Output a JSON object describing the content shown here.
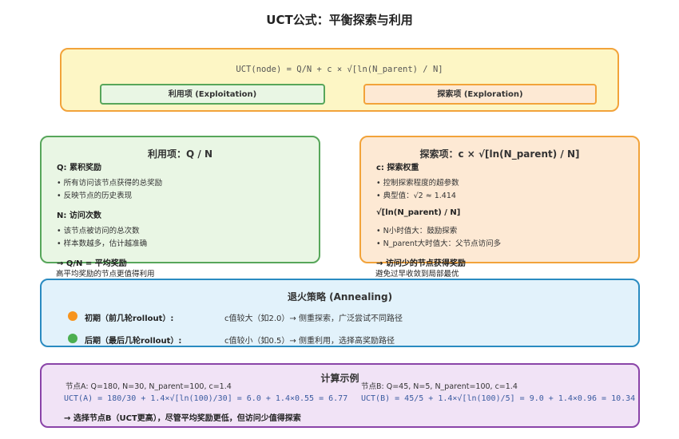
{
  "title": "UCT公式：平衡探索与利用",
  "formula": {
    "text": "UCT(node) = Q/N + c × √[ln(N_parent) / N]",
    "exploit_label": "利用项 (Exploitation)",
    "explore_label": "探索项 (Exploration)"
  },
  "exploit": {
    "title": "利用项：Q / N",
    "q_heading": "Q: 累积奖励",
    "q_items": [
      "• 所有访问该节点获得的总奖励",
      "• 反映节点的历史表现"
    ],
    "n_heading": "N: 访问次数",
    "n_items": [
      "• 该节点被访问的总次数",
      "• 样本数越多，估计越准确"
    ],
    "conclusion": "→ Q/N = 平均奖励",
    "note": "高平均奖励的节点更值得利用"
  },
  "explore": {
    "title": "探索项：c × √[ln(N_parent) / N]",
    "c_heading": "c: 探索权重",
    "c_items": [
      "• 控制探索程度的超参数",
      "• 典型值：√2 ≈ 1.414"
    ],
    "sqrt_heading": "√[ln(N_parent) / N]",
    "sqrt_items": [
      "• N小时值大：鼓励探索",
      "• N_parent大时值大：父节点访问多"
    ],
    "conclusion": "→ 访问少的节点获得奖励",
    "note": "避免过早收敛到局部最优"
  },
  "annealing": {
    "title": "退火策略 (Annealing)",
    "early_label": "初期（前几轮rollout）:",
    "early_desc": "c值较大（如2.0）→ 侧重探索，广泛尝试不同路径",
    "late_label": "后期（最后几轮rollout）:",
    "late_desc": "c值较小（如0.5）→ 侧重利用，选择高奖励路径",
    "colors": {
      "early": "#f7941d",
      "late": "#4caf50"
    }
  },
  "calc": {
    "title": "计算示例",
    "node_a": "节点A: Q=180, N=30, N_parent=100, c=1.4",
    "node_b": "节点B: Q=45, N=5, N_parent=100, c=1.4",
    "formula_a": "UCT(A) = 180/30 + 1.4×√[ln(100)/30] = 6.0 + 1.4×0.55 = 6.77",
    "formula_b": "UCT(B) = 45/5 + 1.4×√[ln(100)/5] = 9.0 + 1.4×0.96 = 10.34",
    "conclusion": "→ 选择节点B（UCT更高），尽管平均奖励更低，但访问少值得探索"
  },
  "colors": {
    "exploit_border": "#57a65a",
    "explore_border": "#f2a33a",
    "anneal_border": "#2a8bc1",
    "calc_border": "#8a44a8"
  }
}
